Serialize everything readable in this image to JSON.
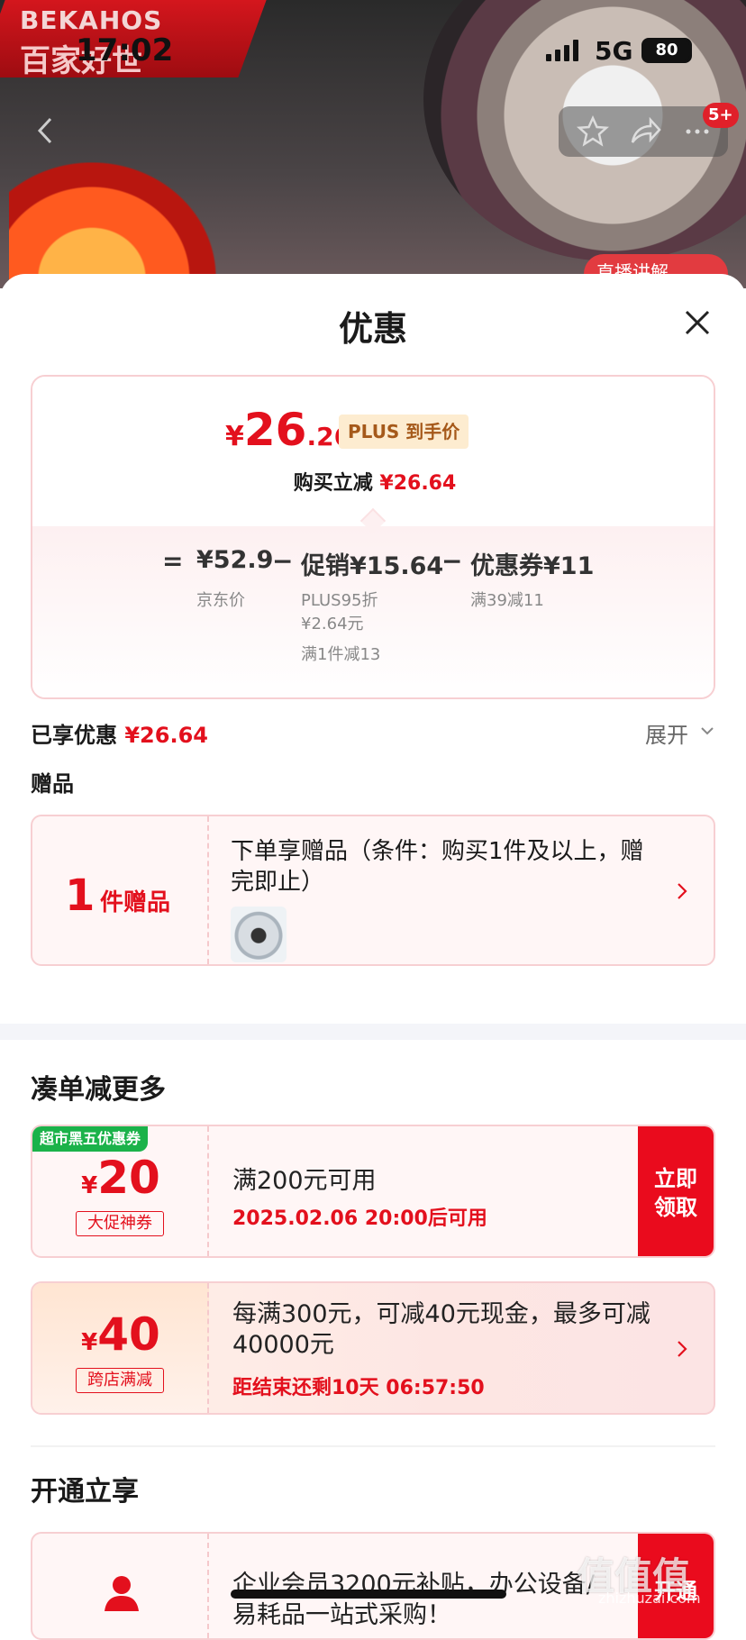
{
  "status_bar": {
    "time": "17:02",
    "network": "5G",
    "battery": "80"
  },
  "hero": {
    "brand_top": "BEKAHOS",
    "brand_bottom": "百家好世",
    "badge": "5+",
    "live_label": "直播讲解"
  },
  "sheet": {
    "title": "优惠",
    "price": {
      "currency": "¥",
      "integer": "26",
      "decimal": ".26",
      "plus_tag": "PLUS 到手价",
      "buy_prefix": "购买立减",
      "buy_amount": "¥26.64"
    },
    "calc": {
      "eq": "=",
      "jd_price": "¥52.9",
      "jd_label": "京东价",
      "minus1": "−",
      "promo": "促销¥15.64",
      "promo_sub1": "PLUS95折",
      "promo_sub2": "¥2.64元",
      "promo_sub3": "满1件减13",
      "minus2": "−",
      "coupon": "优惠券¥11",
      "coupon_sub": "满39减11"
    },
    "saved": {
      "label": "已享优惠",
      "amount": "¥26.64",
      "expand": "展开"
    },
    "gift": {
      "section": "赠品",
      "count": "1",
      "count_unit": "件赠品",
      "desc": "下单享赠品（条件：购买1件及以上，赠完即止）"
    },
    "more": {
      "title": "凑单减更多",
      "coupon_a": {
        "tag": "超市黑五优惠券",
        "currency": "¥",
        "value": "20",
        "type": "大促神券",
        "title": "满200元可用",
        "sub": "2025.02.06 20:00后可用",
        "button": "立即领取",
        "button_l1": "立即",
        "button_l2": "领取"
      },
      "coupon_b": {
        "currency": "¥",
        "value": "40",
        "type": "跨店满减",
        "title": "每满300元，可减40元现金，最多可减40000元",
        "sub": "距结束还剩10天 06:57:50"
      }
    },
    "open": {
      "title": "开通立享",
      "desc": "企业会员3200元补贴，办公设备/易耗品一站式采购！",
      "button": "开通"
    }
  },
  "watermark": {
    "main": "值值值",
    "sub": "zhizhuzai.com"
  },
  "colors": {
    "accent": "#e3101d",
    "green_tag": "#1bb24a",
    "button": "#ea0b1d"
  }
}
